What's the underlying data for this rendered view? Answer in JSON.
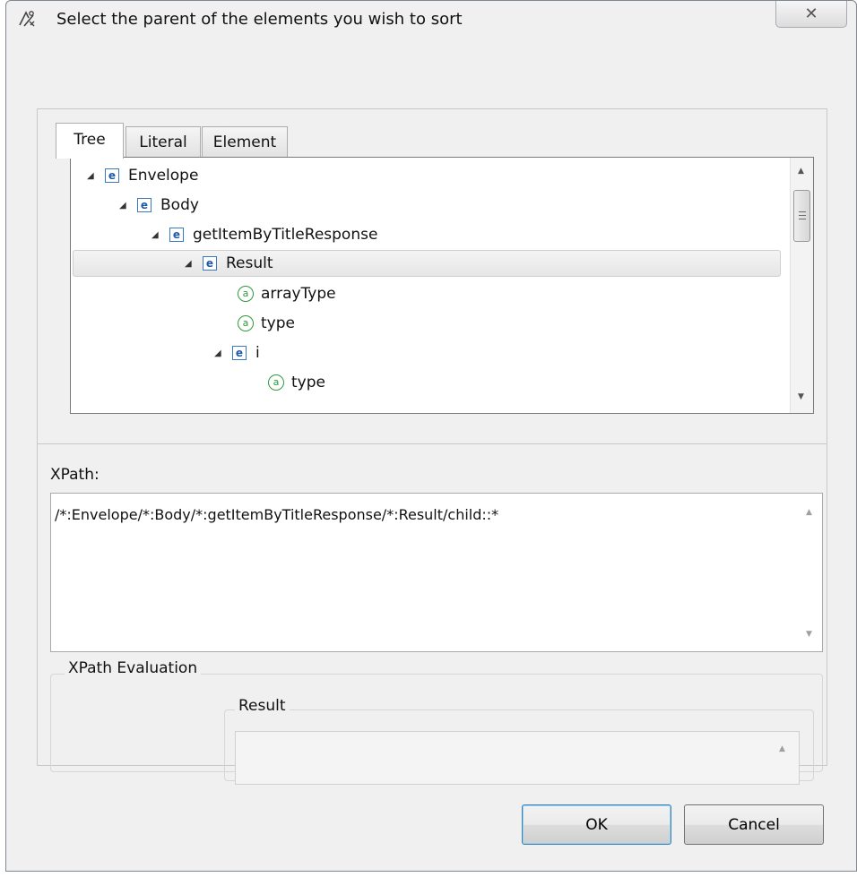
{
  "dialog": {
    "title": "Select the parent of the elements you wish to sort",
    "close_glyph": "✕"
  },
  "tabs": [
    {
      "label": "Tree",
      "active": true
    },
    {
      "label": "Literal",
      "active": false
    },
    {
      "label": "Element",
      "active": false
    }
  ],
  "tree": {
    "nodes": [
      {
        "label": "Envelope",
        "type": "element",
        "depth": 0,
        "expanded": true
      },
      {
        "label": "Body",
        "type": "element",
        "depth": 1,
        "expanded": true
      },
      {
        "label": "getItemByTitleResponse",
        "type": "element",
        "depth": 2,
        "expanded": true
      },
      {
        "label": "Result",
        "type": "element",
        "depth": 3,
        "expanded": true,
        "selected": true
      },
      {
        "label": "arrayType",
        "type": "attribute",
        "depth": 4
      },
      {
        "label": "type",
        "type": "attribute",
        "depth": 4
      },
      {
        "label": "i",
        "type": "element",
        "depth": 4,
        "expanded": true
      },
      {
        "label": "type",
        "type": "attribute",
        "depth": 5
      }
    ],
    "element_icon_letter": "e",
    "attribute_icon_letter": "a"
  },
  "xpath": {
    "label": "XPath:",
    "value": "/*:Envelope/*:Body/*:getItemByTitleResponse/*:Result/child::*"
  },
  "evaluation": {
    "group_label": "XPath Evaluation",
    "result_label": "Result"
  },
  "buttons": {
    "ok": "OK",
    "cancel": "Cancel"
  },
  "colors": {
    "element_icon": "#1e5aa8",
    "attribute_icon": "#2e9a3c",
    "default_button_border": "#3c7fb1"
  }
}
